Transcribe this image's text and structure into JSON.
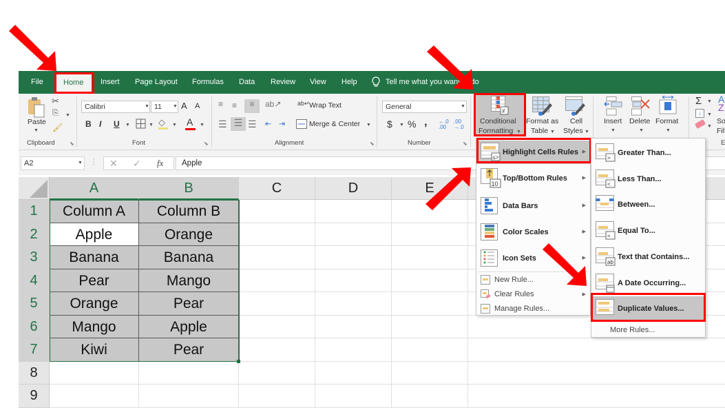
{
  "tabs": [
    {
      "label": "File"
    },
    {
      "label": "Home",
      "active": true
    },
    {
      "label": "Insert"
    },
    {
      "label": "Page Layout"
    },
    {
      "label": "Formulas"
    },
    {
      "label": "Data"
    },
    {
      "label": "Review"
    },
    {
      "label": "View"
    },
    {
      "label": "Help"
    }
  ],
  "tell_me": "Tell me what you want to do",
  "ribbon": {
    "clipboard": {
      "paste": "Paste",
      "group": "Clipboard"
    },
    "font": {
      "name": "Calibri",
      "size": "11",
      "bold": "B",
      "italic": "I",
      "underline": "U",
      "grow": "A",
      "shrink": "A",
      "group": "Font"
    },
    "alignment": {
      "wrap_text": "Wrap Text",
      "merge_center": "Merge & Center",
      "group": "Alignment"
    },
    "number": {
      "format": "General",
      "currency": "$",
      "percent": "%",
      "comma": ",",
      "group": "Number"
    },
    "styles": {
      "conditional_formatting_1": "Conditional",
      "conditional_formatting_2": "Formatting",
      "format_as_table_1": "Format as",
      "format_as_table_2": "Table",
      "cell_styles_1": "Cell",
      "cell_styles_2": "Styles"
    },
    "cells": {
      "insert": "Insert",
      "delete": "Delete",
      "format": "Format"
    },
    "editing": {
      "sort_1": "So",
      "sort_2": "Filt",
      "group": "E"
    }
  },
  "formula_bar": {
    "name_box": "A2",
    "fx": "fx",
    "formula": "Apple"
  },
  "sheet": {
    "columns": [
      "A",
      "B",
      "C",
      "D",
      "E"
    ],
    "rows": [
      "1",
      "2",
      "3",
      "4",
      "5",
      "6",
      "7",
      "8",
      "9"
    ],
    "cells": [
      [
        "Column A",
        "Column B"
      ],
      [
        "Apple",
        "Orange"
      ],
      [
        "Banana",
        "Banana"
      ],
      [
        "Pear",
        "Mango"
      ],
      [
        "Orange",
        "Pear"
      ],
      [
        "Mango",
        "Apple"
      ],
      [
        "Kiwi",
        "Pear"
      ]
    ],
    "active_cell": "A2",
    "selection": "A1:B7"
  },
  "cf_menu": {
    "items": [
      {
        "label": "Highlight Cells Rules",
        "underline": "H",
        "submenu": true,
        "highlighted": true
      },
      {
        "label": "Top/Bottom Rules",
        "underline": "T",
        "submenu": true
      },
      {
        "label": "Data Bars",
        "underline": "D",
        "submenu": true
      },
      {
        "label": "Color Scales",
        "underline": "S",
        "submenu": true
      },
      {
        "label": "Icon Sets",
        "underline": "I",
        "submenu": true
      }
    ],
    "secondary": [
      {
        "label": "New Rule..."
      },
      {
        "label": "Clear Rules",
        "submenu": true
      },
      {
        "label": "Manage Rules..."
      }
    ]
  },
  "hcr_submenu": {
    "items": [
      {
        "label": "Greater Than..."
      },
      {
        "label": "Less Than..."
      },
      {
        "label": "Between..."
      },
      {
        "label": "Equal To..."
      },
      {
        "label": "Text that Contains..."
      },
      {
        "label": "A Date Occurring..."
      },
      {
        "label": "Duplicate Values...",
        "highlighted": true
      }
    ],
    "more_rules": "More Rules..."
  },
  "colors": {
    "excel_green": "#217346",
    "annotation_red": "#ff0000",
    "selection_fill": "#c8c8c8"
  }
}
